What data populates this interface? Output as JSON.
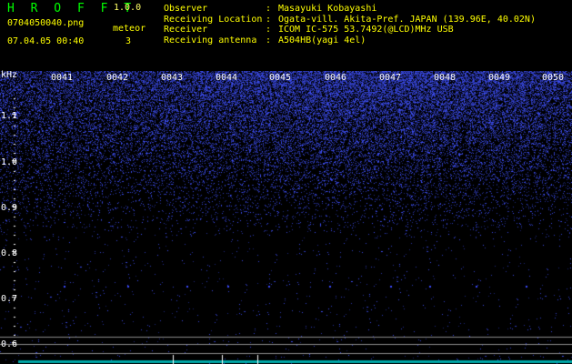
{
  "header": {
    "app_name": "H R O F F T",
    "version": "1.0.0",
    "filename": "0704050040.png",
    "datetime": "07.04.05 00:40",
    "meteor_label": "meteor",
    "meteor_count": "3",
    "info": [
      {
        "label": "Observer",
        "value": "Masayuki Kobayashi"
      },
      {
        "label": "Receiving Location",
        "value": "Ogata-vill. Akita-Pref. JAPAN (139.96E, 40.02N)"
      },
      {
        "label": "Receiver",
        "value": "ICOM IC-575 53.7492(@LCD)MHz USB"
      },
      {
        "label": "Receiving antenna",
        "value": "A504HB(yagi 4el)"
      }
    ]
  },
  "spectrogram": {
    "unit_label": "kHz",
    "time_labels": [
      "0041",
      "0042",
      "0043",
      "0044",
      "0045",
      "0046",
      "0047",
      "0048",
      "0049",
      "0050"
    ],
    "freq_labels": [
      "1.1",
      "1.0",
      "0.9",
      "0.8",
      "0.7",
      "0.6"
    ]
  },
  "colors": {
    "title": "#00ff00",
    "version": "#ffff66",
    "text_yellow": "#ffff00",
    "text_white": "#ffffff",
    "noise": "#3a4aff",
    "baseline": "#00aaaa"
  }
}
